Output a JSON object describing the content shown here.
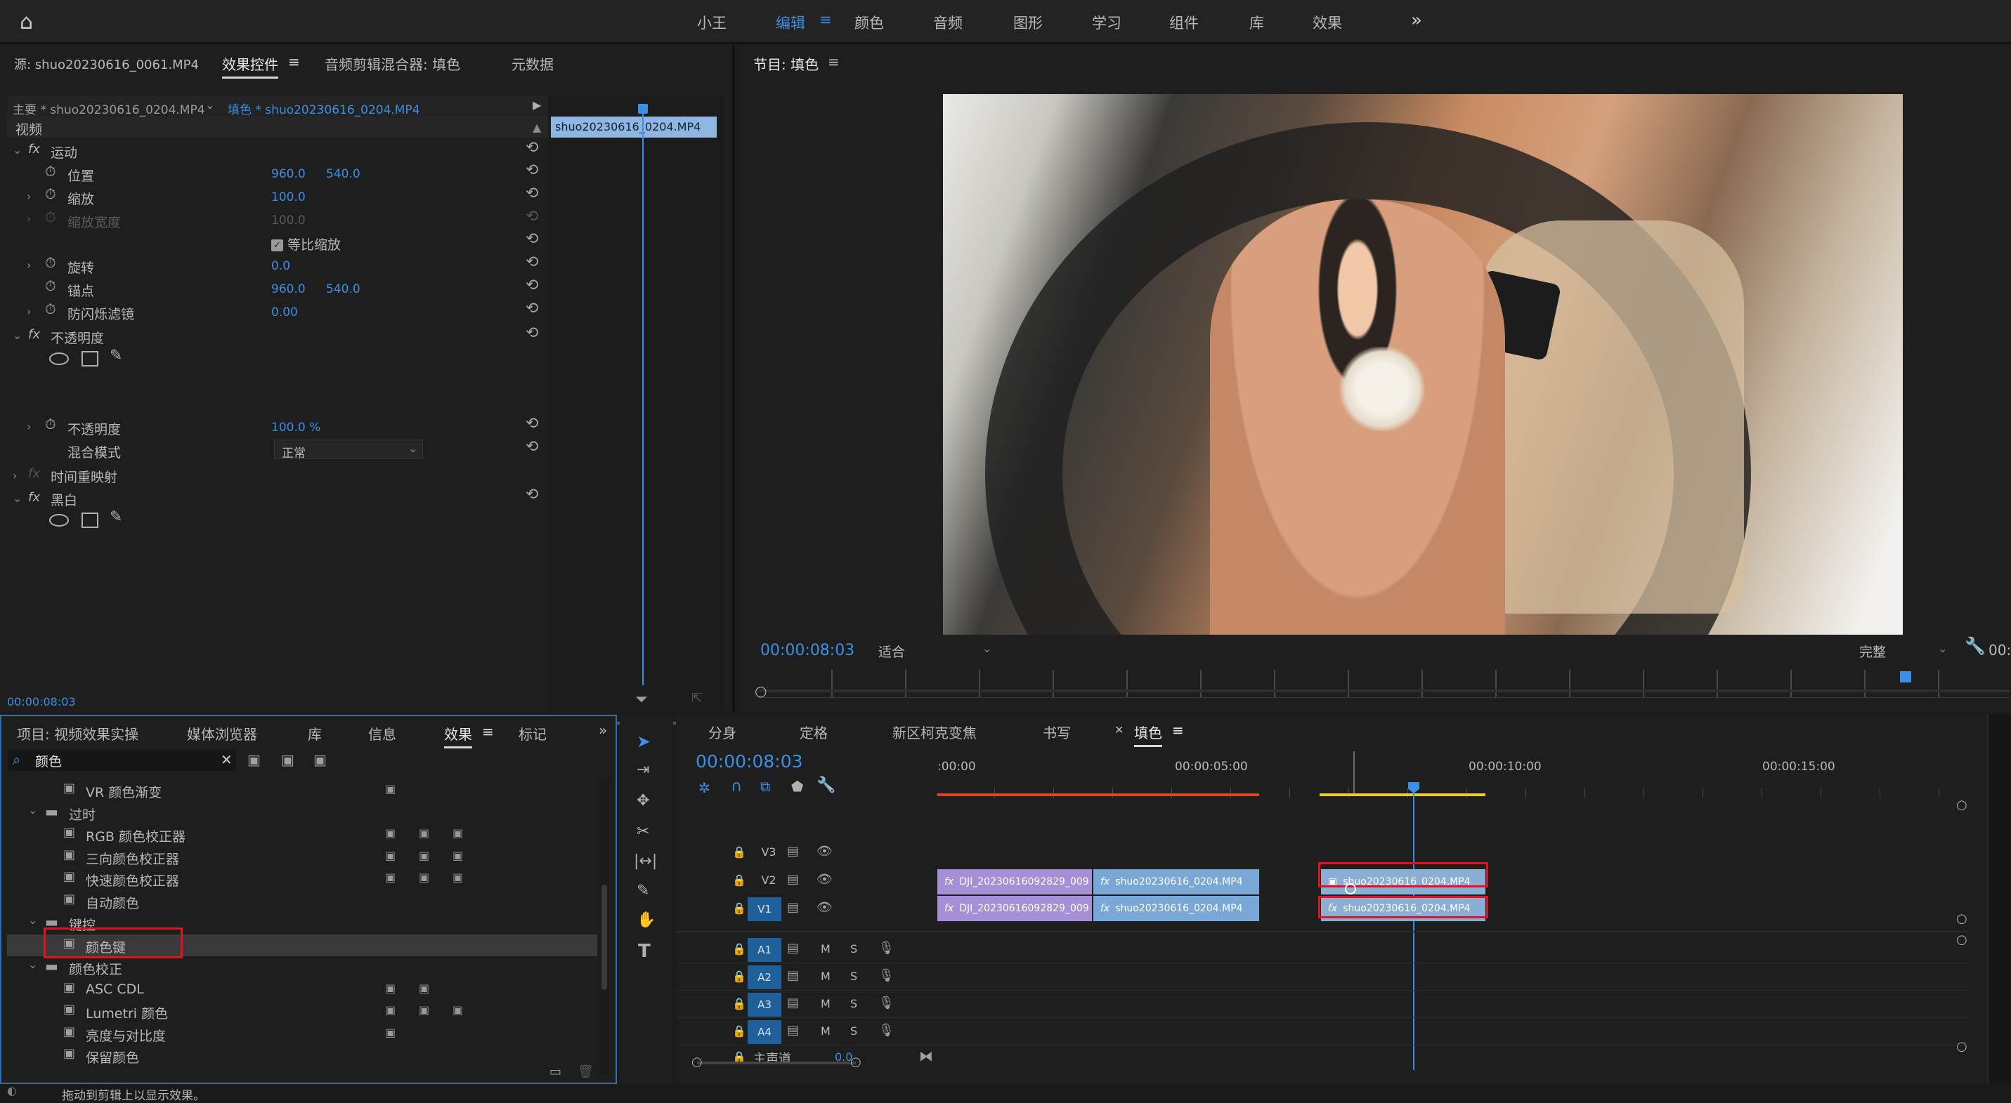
{
  "topbar": {
    "tabs": [
      "小王",
      "编辑",
      "颜色",
      "音频",
      "图形",
      "学习",
      "组件",
      "库",
      "效果"
    ],
    "more": "»"
  },
  "source_panel": {
    "tabs": [
      "源: shuo20230616_0061.MP4",
      "效果控件",
      "音频剪辑混合器: 填色",
      "元数据"
    ],
    "master_clip": "主要 * shuo20230616_0204.MP4",
    "sequence_clip": "填色 * shuo20230616_0204.MP4",
    "clip_chip": "shuo20230616_0204.MP4",
    "timecode": "00:00:08:03"
  },
  "effect_controls": {
    "video_header": "视频",
    "motion": "运动",
    "position": "位置",
    "position_x": "960.0",
    "position_y": "540.0",
    "scale": "缩放",
    "scale_val": "100.0",
    "scale_width": "缩放宽度",
    "scale_width_val": "100.0",
    "uniform_scale": "等比缩放",
    "rotation": "旋转",
    "rotation_val": "0.0",
    "anchor": "锚点",
    "anchor_x": "960.0",
    "anchor_y": "540.0",
    "antiflicker": "防闪烁滤镜",
    "antiflicker_val": "0.00",
    "opacity_group": "不透明度",
    "opacity": "不透明度",
    "opacity_val": "100.0 %",
    "blend_mode": "混合模式",
    "blend_val": "正常",
    "time_remap": "时间重映射",
    "black_white": "黑白"
  },
  "program": {
    "title": "节目: 填色",
    "timecode": "00:00:08:03",
    "fit": "适合",
    "quality": "完整",
    "right_tc": "00:"
  },
  "effects_panel": {
    "tabs": [
      "项目: 视频效果实操",
      "媒体浏览器",
      "库",
      "信息",
      "效果",
      "标记"
    ],
    "search_value": "颜色",
    "items": [
      {
        "label": "VR 颜色渐变",
        "indent": 2,
        "type": "fx",
        "badges": 1
      },
      {
        "label": "过时",
        "indent": 1,
        "type": "folder",
        "badges": 0
      },
      {
        "label": "RGB 颜色校正器",
        "indent": 2,
        "type": "fx",
        "badges": 3
      },
      {
        "label": "三向颜色校正器",
        "indent": 2,
        "type": "fx",
        "badges": 3
      },
      {
        "label": "快速颜色校正器",
        "indent": 2,
        "type": "fx",
        "badges": 3
      },
      {
        "label": "自动颜色",
        "indent": 2,
        "type": "fx",
        "badges": 0
      },
      {
        "label": "键控",
        "indent": 1,
        "type": "folder",
        "badges": 0
      },
      {
        "label": "颜色键",
        "indent": 2,
        "type": "fx",
        "badges": 0,
        "selected": true
      },
      {
        "label": "颜色校正",
        "indent": 1,
        "type": "folder",
        "badges": 0
      },
      {
        "label": "ASC CDL",
        "indent": 2,
        "type": "fx",
        "badges": 2
      },
      {
        "label": "Lumetri 颜色",
        "indent": 2,
        "type": "fx",
        "badges": 3
      },
      {
        "label": "亮度与对比度",
        "indent": 2,
        "type": "fx",
        "badges": 1
      },
      {
        "label": "保留颜色",
        "indent": 2,
        "type": "fx",
        "badges": 0
      }
    ]
  },
  "timeline": {
    "tabs": [
      "分身",
      "定格",
      "新区柯克变焦",
      "书写",
      "填色"
    ],
    "timecode": "00:00:08:03",
    "ruler": [
      ":00:00",
      "00:00:05:00",
      "00:00:10:00",
      "00:00:15:00"
    ],
    "video_tracks": [
      "V3",
      "V2",
      "V1"
    ],
    "audio_tracks": [
      "A1",
      "A2",
      "A3",
      "A4"
    ],
    "master": "主声道",
    "master_val": "0.0",
    "clips_v2": [
      "DJI_20230616092829_009",
      "shuo20230616_0204.MP4",
      "shuo20230616_0204.MP4"
    ],
    "clips_v1": [
      "DJI_20230616092829_009",
      "shuo20230616_0204.MP4",
      "shuo20230616_0204.MP4"
    ],
    "track_m": "M",
    "track_s": "S"
  },
  "status": {
    "text": "拖动到剪辑上以显示效果。"
  },
  "colors": {
    "accent": "#3d8fe6",
    "highlight_red": "#e0141e",
    "clip_purple": "#a58fd6",
    "clip_blue": "#7aa8d6"
  }
}
